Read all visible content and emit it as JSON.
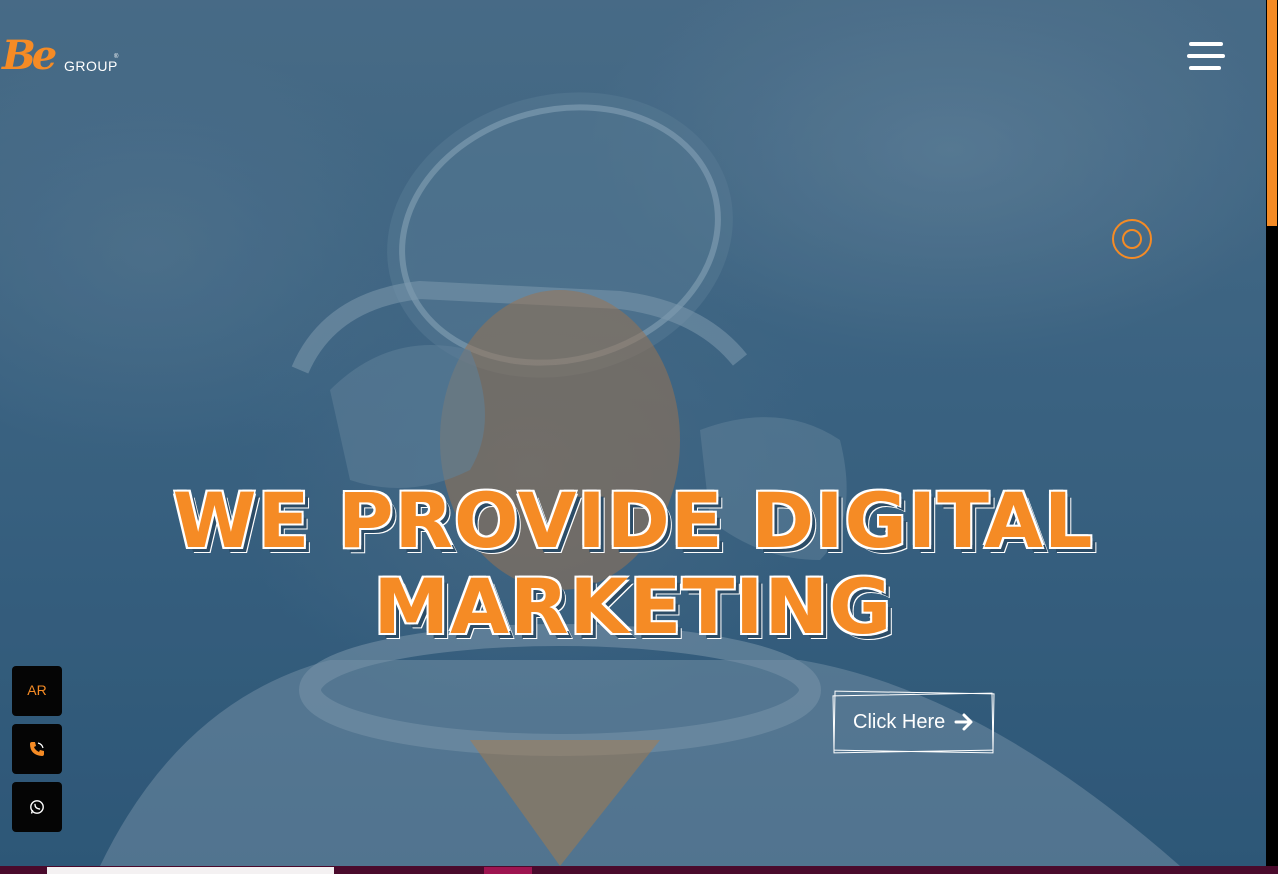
{
  "brand": {
    "logo_mark": "Be",
    "logo_word": "GROUP",
    "logo_reg": "®",
    "accent_color": "#f58b25"
  },
  "header": {
    "menu_icon": "hamburger-menu-icon"
  },
  "hero": {
    "headline_line1": "WE PROVIDE DIGITAL",
    "headline_line2": "MARKETING",
    "cta_label": "Click Here",
    "cta_icon": "arrow-right-icon",
    "decor_icon": "ring-icon"
  },
  "side_actions": {
    "language_label": "AR",
    "phone_icon": "phone-icon",
    "whatsapp_icon": "whatsapp-icon"
  }
}
